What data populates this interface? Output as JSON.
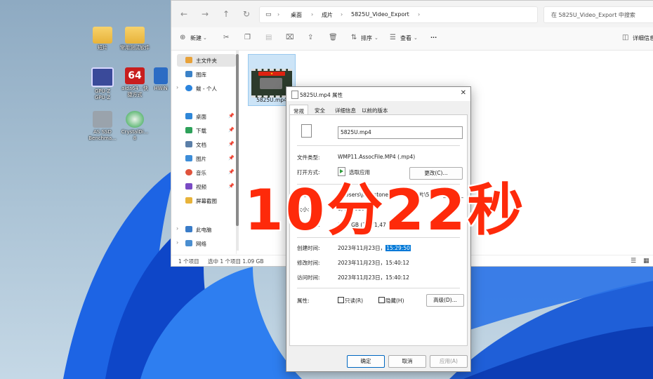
{
  "desktop": {
    "icons": [
      {
        "label": "短片"
      },
      {
        "label": "常用测试软件"
      },
      {
        "label": "GPU-Z\nGPU-Z"
      },
      {
        "label": "aida64 - 快\n捷方式"
      },
      {
        "label": "HWiN"
      },
      {
        "label": "AS SSD\nBenchma..."
      },
      {
        "label": "CrystalDi...\n8"
      }
    ]
  },
  "explorer": {
    "nav": {
      "back": "←",
      "forward": "→",
      "up": "↑",
      "refresh": "↻"
    },
    "breadcrumb": [
      "桌面",
      "成片",
      "5825U_Video_Export"
    ],
    "search_placeholder": "在 5825U_Video_Export 中搜索",
    "toolbar": {
      "new": "新建",
      "sort": "排序",
      "view": "查看",
      "more": "···",
      "details": "详细信息"
    },
    "sidebar": [
      {
        "label": "主文件夹",
        "selected": true
      },
      {
        "label": "图库"
      },
      {
        "label": "鲅 - 个人"
      },
      {
        "label": "桌面"
      },
      {
        "label": "下载"
      },
      {
        "label": "文档"
      },
      {
        "label": "图片"
      },
      {
        "label": "音乐"
      },
      {
        "label": "视频"
      },
      {
        "label": "屏幕截图"
      },
      {
        "label": "此电脑"
      },
      {
        "label": "网络"
      }
    ],
    "file": {
      "name": "5825U.mp4"
    },
    "status": {
      "count": "1 个项目",
      "selected": "选中 1 个项目 1.09 GB"
    }
  },
  "dialog": {
    "title": "5825U.mp4 属性",
    "close": "✕",
    "tabs": [
      "常规",
      "安全",
      "详细信息",
      "以前的版本"
    ],
    "filename": "5825U.mp4",
    "file_type_label": "文件类型:",
    "file_type_value": "WMP11.AssocFile.MP4 (.mp4)",
    "open_with_label": "打开方式:",
    "open_with_value": "选取应用",
    "change_button": "更改(C)...",
    "location_label": "位置:",
    "location_value": "C:\\Users\\jack stone\\Desktop\\成片\\5825U_Video_",
    "size_label": "大小:",
    "size_value": "1,434,610",
    "size_on_disk_label": "占用空间:",
    "size_on_disk_value": "1.09 GB (1,171,47 ,920 字节)",
    "created_label": "创建时间:",
    "created_date": "2023年11月23日，",
    "created_time": "15:29:50",
    "modified_label": "修改时间:",
    "modified_value": "2023年11月23日，15:40:12",
    "accessed_label": "访问时间:",
    "accessed_value": "2023年11月23日，15:40:12",
    "attributes_label": "属性:",
    "readonly": "只读(R)",
    "hidden": "隐藏(H)",
    "advanced": "高级(D)...",
    "ok": "确定",
    "cancel": "取消",
    "apply": "应用(A)"
  },
  "overlay_text": "10分22秒",
  "colors": {
    "overlay": "#fe2a0a",
    "selection": "#0078d7",
    "accent": "#0067c0"
  }
}
